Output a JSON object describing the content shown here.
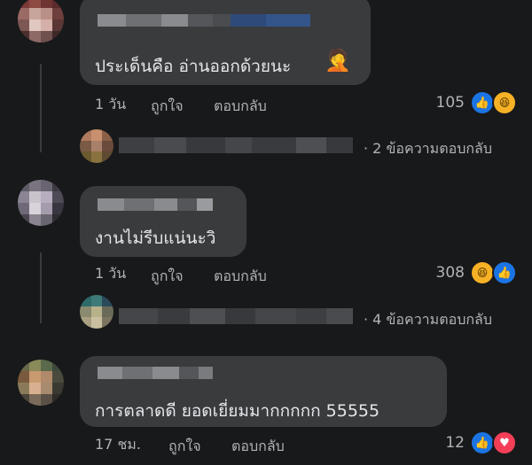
{
  "comments": [
    {
      "text": "ประเด็นคือ อ่านออกด้วยนะ",
      "time": "1 วัน",
      "like_label": "ถูกใจ",
      "reply_label": "ตอบกลับ",
      "reaction_count": "105",
      "reactions": [
        "like-icon",
        "haha-icon"
      ],
      "emoji": "🤦",
      "replies_text": "· 2 ข้อความตอบกลับ"
    },
    {
      "text": "งานไม่รีบแน่นะวิ",
      "time": "1 วัน",
      "like_label": "ถูกใจ",
      "reply_label": "ตอบกลับ",
      "reaction_count": "308",
      "reactions": [
        "haha-icon",
        "like-icon"
      ],
      "replies_text": "· 4 ข้อความตอบกลับ"
    },
    {
      "text": "การตลาดดี ยอดเยี่ยมมากกกกก 55555",
      "time": "17 ชม.",
      "like_label": "ถูกใจ",
      "reply_label": "ตอบกลับ",
      "reaction_count": "12",
      "reactions": [
        "like-icon",
        "love-icon"
      ]
    }
  ],
  "colors": {
    "background": "#18191a",
    "bubble": "#3a3b3c",
    "like": "#1b74e4",
    "haha": "#f7b125",
    "love": "#f33e58"
  }
}
